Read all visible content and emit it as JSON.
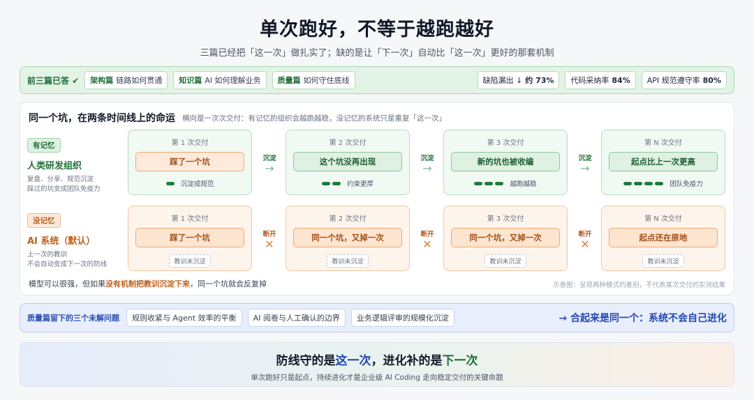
{
  "header": {
    "title": "单次跑好，不等于越跑越好",
    "subtitle": "三篇已经把「这一次」做扎实了；缺的是让「下一次」自动比「这一次」更好的那套机制"
  },
  "recap": {
    "label": "前三篇已答 ✔",
    "chips": [
      {
        "name": "架构篇",
        "text": "链路如何贯通"
      },
      {
        "name": "知识篇",
        "text": "AI 如何理解业务"
      },
      {
        "name": "质量篇",
        "text": "如何守住底线"
      }
    ],
    "metrics": [
      {
        "label": "缺陷漏出 ↓",
        "value": "约 73%"
      },
      {
        "label": "代码采纳率",
        "value": "84%"
      },
      {
        "label": "API 规范遵守率",
        "value": "80%"
      }
    ]
  },
  "panel": {
    "title": "同一个坑，在两条时间线上的命运",
    "subtitle": "横向是一次次交付：有记忆的组织会越跑越稳，没记忆的系统只是重复「这一次」",
    "rows": [
      {
        "tag": "有记忆",
        "name": "人类研发组织",
        "desc1": "复盘、分享、规范沉淀",
        "desc2": "踩过的坑变成团队免疫力",
        "connector_label": "沉淀",
        "connector_arrow": "→",
        "cards": [
          {
            "head": "第 1 次交付",
            "box": "踩了一个坑",
            "foot": "沉淀成规范",
            "pills": 1
          },
          {
            "head": "第 2 次交付",
            "box": "这个坑没再出现",
            "foot": "约束更厚",
            "pills": 2
          },
          {
            "head": "第 3 次交付",
            "box": "新的坑也被收编",
            "foot": "越跑越稳",
            "pills": 3
          },
          {
            "head": "第 N 次交付",
            "box": "起点比上一次更高",
            "foot": "团队免疫力",
            "pills": 4
          }
        ]
      },
      {
        "tag": "没记忆",
        "name": "AI 系统（默认）",
        "desc1": "上一次的教训",
        "desc2": "不会自动变成下一次的防线",
        "connector_label": "断开",
        "connector_arrow": "✕",
        "cards": [
          {
            "head": "第 1 次交付",
            "box": "踩了一个坑",
            "foot": "教训未沉淀"
          },
          {
            "head": "第 2 次交付",
            "box": "同一个坑，又掉一次",
            "foot": "教训未沉淀"
          },
          {
            "head": "第 3 次交付",
            "box": "同一个坑，又掉一次",
            "foot": "教训未沉淀"
          },
          {
            "head": "第 N 次交付",
            "box": "起点还在原地",
            "foot": "教训未沉淀"
          }
        ]
      }
    ],
    "note_pre": "模型可以很强，但如果",
    "note_hl": "没有机制把教训沉淀下来",
    "note_post": "，同一个坑就会反复掉",
    "caption": "示意图：呈现两种模式的差别，不代表某次交付的实测结果"
  },
  "issues": {
    "label": "质量篇留下的三个未解问题",
    "chips": [
      "规则收紧与 Agent 效率的平衡",
      "AI 阅卷与人工确认的边界",
      "业务逻辑评审的规模化沉淀"
    ],
    "conclusion": "→ 合起来是同一个：系统不会自己进化"
  },
  "banner": {
    "pre": "防线守的是",
    "blue": "这一次",
    "mid": "，进化补的是",
    "green": "下一次",
    "sub": "单次跑好只是起点，持续进化才是企业级 AI Coding 走向稳定交付的关键命题"
  }
}
